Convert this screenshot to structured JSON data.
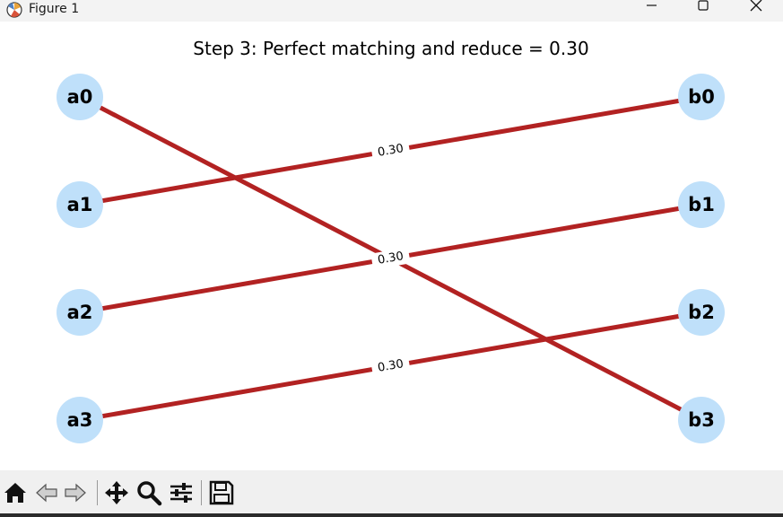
{
  "window": {
    "title": "Figure 1",
    "controls": [
      "minimize-icon",
      "maximize-icon",
      "close-icon"
    ]
  },
  "figure": {
    "title": "Step 3: Perfect matching and reduce = 0.30",
    "colors": {
      "node_fill": "#bfe0fa",
      "edge": "#b22222",
      "label_bg": "#ffffff"
    }
  },
  "graph": {
    "left_nodes": [
      "a0",
      "a1",
      "a2",
      "a3"
    ],
    "right_nodes": [
      "b0",
      "b1",
      "b2",
      "b3"
    ],
    "edges": [
      {
        "from": "a0",
        "to": "b3",
        "label": ""
      },
      {
        "from": "a1",
        "to": "b0",
        "label": "0.30"
      },
      {
        "from": "a2",
        "to": "b1",
        "label": "0.30"
      },
      {
        "from": "a3",
        "to": "b2",
        "label": "0.30"
      }
    ]
  },
  "toolbar": {
    "buttons": [
      "home-icon",
      "back-icon",
      "forward-icon",
      "pan-icon",
      "zoom-icon",
      "configure-subplots-icon",
      "save-icon"
    ]
  }
}
